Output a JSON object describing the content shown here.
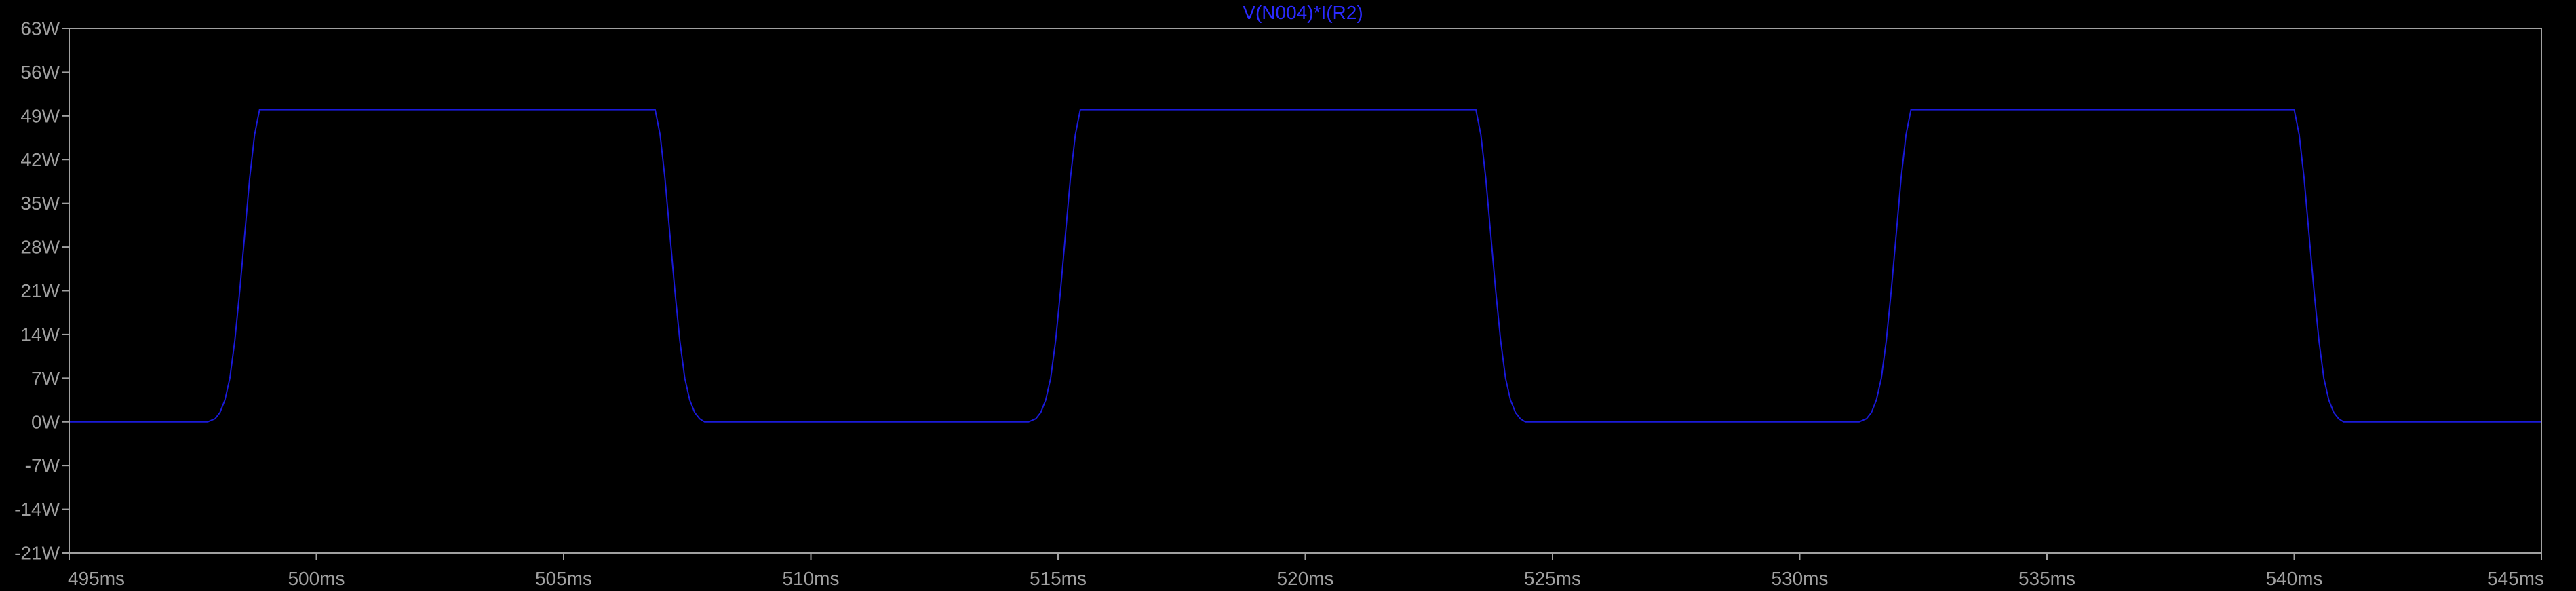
{
  "colors": {
    "background": "#000000",
    "axis": "#a0a0a0",
    "tick_label": "#a0a0a0",
    "trace": "#1a1ad9",
    "title": "#2a2aff"
  },
  "chart_data": {
    "type": "line",
    "title": "V(N004)*I(R2)",
    "xlabel": "",
    "ylabel": "",
    "xlim": [
      495,
      545
    ],
    "ylim": [
      -21,
      63
    ],
    "grid": false,
    "legend": "none",
    "x_unit": "ms",
    "y_unit": "W",
    "x_ticks": [
      495,
      500,
      505,
      510,
      515,
      520,
      525,
      530,
      535,
      540,
      545
    ],
    "x_tick_labels": [
      "495ms",
      "500ms",
      "505ms",
      "510ms",
      "515ms",
      "520ms",
      "525ms",
      "530ms",
      "535ms",
      "540ms",
      "545ms"
    ],
    "y_ticks": [
      63,
      56,
      49,
      42,
      35,
      28,
      21,
      14,
      7,
      0,
      -7,
      -14,
      -21
    ],
    "y_tick_labels": [
      "63W",
      "56W",
      "49W",
      "42W",
      "35W",
      "28W",
      "21W",
      "14W",
      "7W",
      "0W",
      "-7W",
      "-14W",
      "-21W"
    ],
    "series": [
      {
        "x": [
          495.0,
          497.8,
          497.95,
          498.05,
          498.15,
          498.25,
          498.35,
          498.45,
          498.55,
          498.65,
          498.75,
          498.85,
          506.85,
          506.95,
          507.05,
          507.15,
          507.25,
          507.35,
          507.45,
          507.55,
          507.65,
          507.75,
          507.85,
          514.4,
          514.55,
          514.65,
          514.75,
          514.85,
          514.95,
          515.05,
          515.15,
          515.25,
          515.35,
          515.45,
          523.45,
          523.55,
          523.65,
          523.75,
          523.85,
          523.95,
          524.05,
          524.15,
          524.25,
          524.35,
          524.45,
          531.2,
          531.35,
          531.45,
          531.55,
          531.65,
          531.75,
          531.85,
          531.95,
          532.05,
          532.15,
          532.25,
          540.0,
          540.1,
          540.2,
          540.3,
          540.4,
          540.5,
          540.6,
          540.7,
          540.8,
          540.9,
          541.0,
          545.0
        ],
        "values": [
          0,
          0,
          0.5,
          1.5,
          3.5,
          7,
          13,
          21,
          30,
          39,
          46,
          50,
          50,
          46,
          39,
          30,
          21,
          13,
          7,
          3.5,
          1.5,
          0.5,
          0,
          0,
          0.5,
          1.5,
          3.5,
          7,
          13,
          21,
          30,
          39,
          46,
          50,
          50,
          46,
          39,
          30,
          21,
          13,
          7,
          3.5,
          1.5,
          0.5,
          0,
          0,
          0.5,
          1.5,
          3.5,
          7,
          13,
          21,
          30,
          39,
          46,
          50,
          50,
          46,
          39,
          30,
          21,
          13,
          7,
          3.5,
          1.5,
          0.5,
          0,
          0
        ]
      }
    ]
  }
}
